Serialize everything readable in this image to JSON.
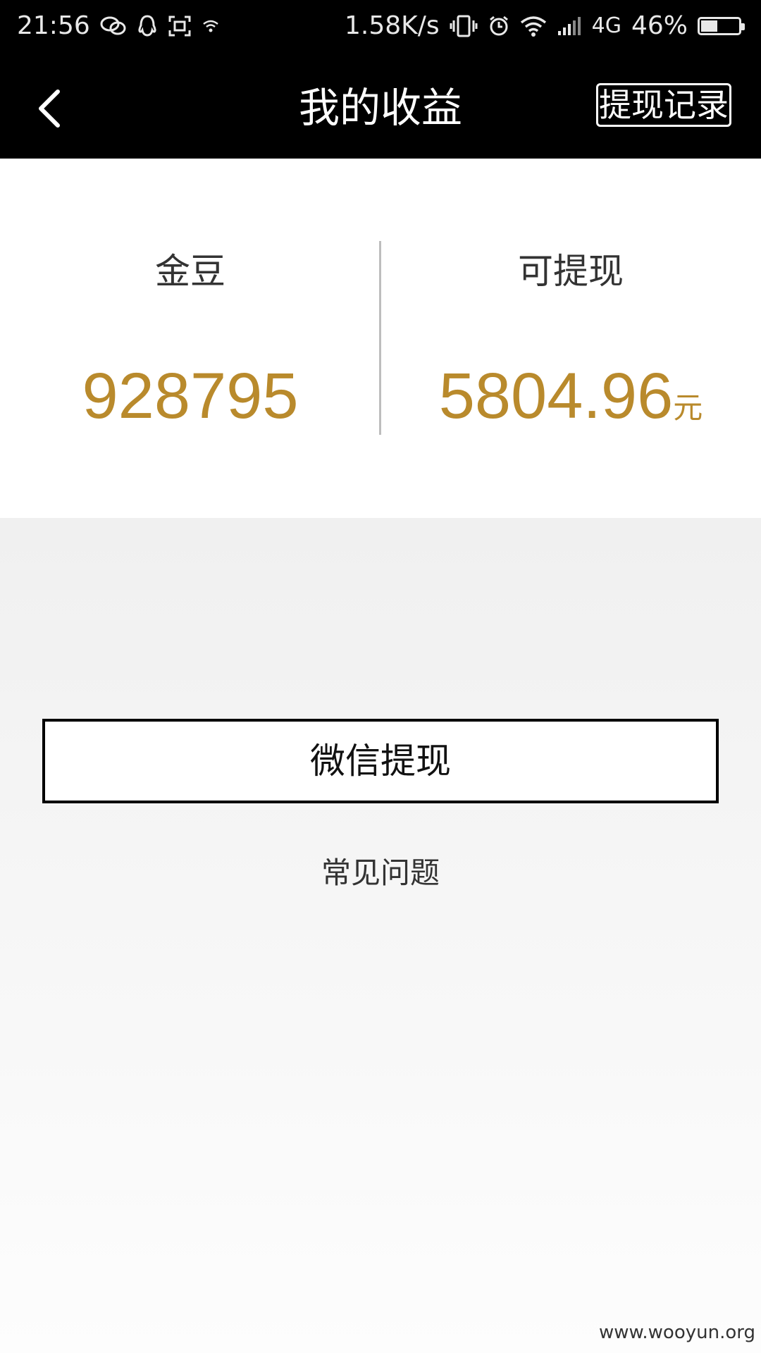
{
  "status_bar": {
    "time": "21:56",
    "speed": "1.58K/s",
    "network": "4G",
    "battery_pct": "46%",
    "battery_level": 0.46,
    "icons": [
      "wechat-icon",
      "qq-icon",
      "screenshot-icon",
      "wifi-small-icon",
      "vibrate-icon",
      "alarm-icon",
      "wifi-icon",
      "signal-icon",
      "battery-icon"
    ]
  },
  "nav": {
    "title": "我的收益",
    "record_label": "提现记录",
    "back_icon": "chevron-left-icon"
  },
  "earnings": {
    "beans_label": "金豆",
    "beans_value": "928795",
    "withdrawable_label": "可提现",
    "withdrawable_value": "5804.96",
    "withdrawable_unit": "元"
  },
  "actions": {
    "wechat_withdraw_label": "微信提现",
    "faq_label": "常见问题"
  },
  "watermark": "www.wooyun.org",
  "colors": {
    "accent_gold": "#b98a2c",
    "nav_bg": "#000000",
    "lower_bg": "#f0f0f0"
  }
}
